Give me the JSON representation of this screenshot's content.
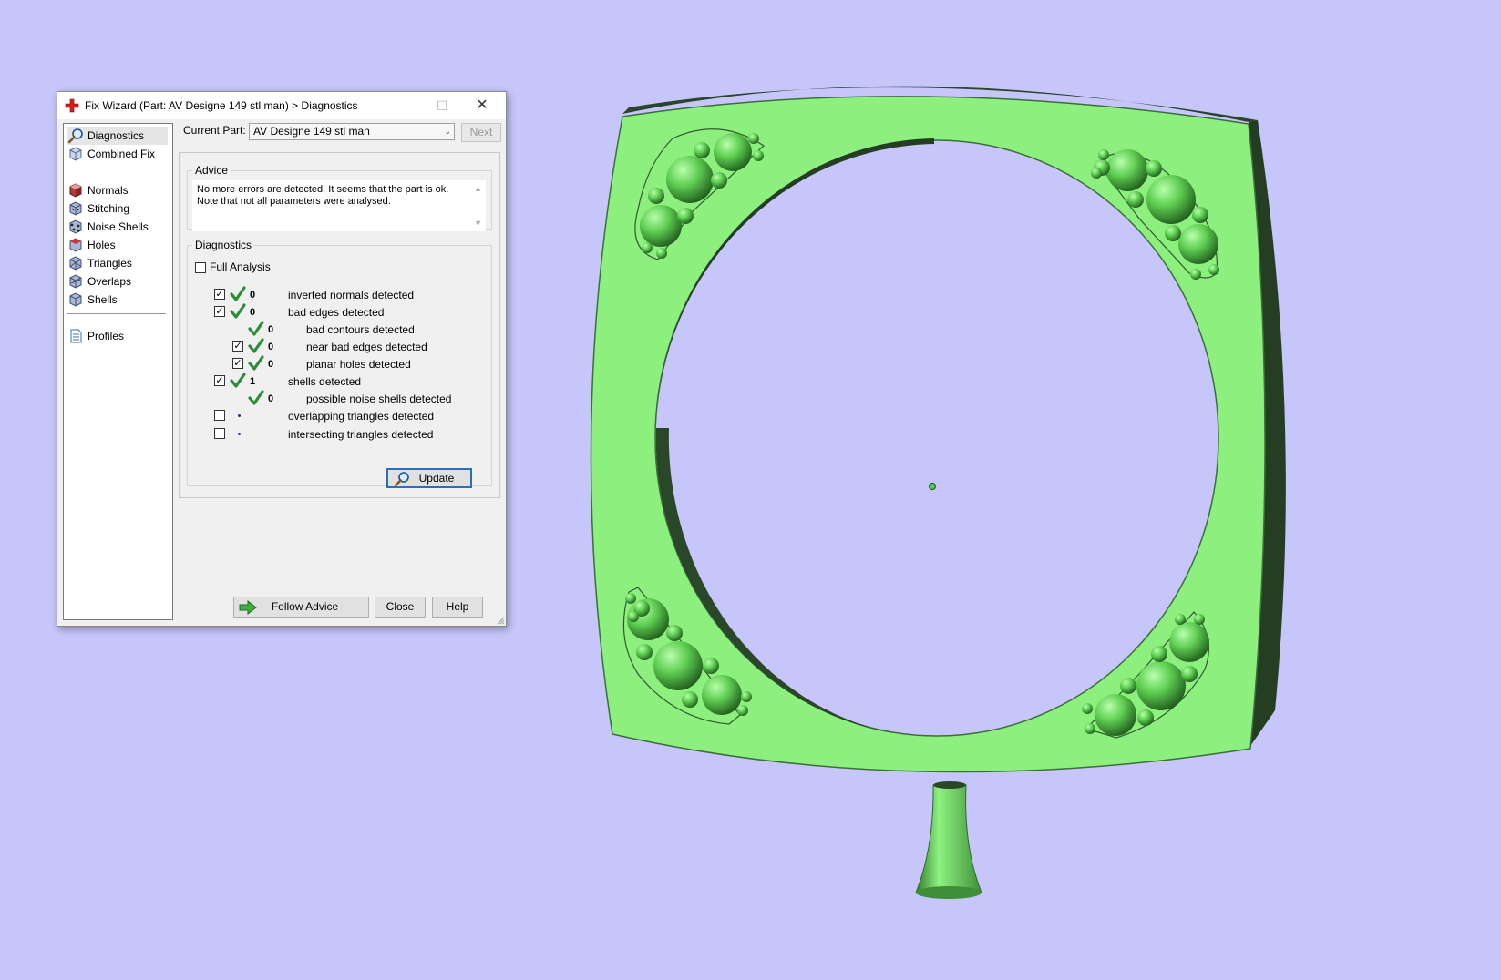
{
  "dialog": {
    "title": "Fix Wizard (Part: AV Designe 149 stl man) > Diagnostics",
    "current_part_label": "Current Part:",
    "current_part_value": "AV Designe 149 stl man",
    "next_label": "Next",
    "nav": {
      "items": [
        {
          "label": "Diagnostics",
          "icon": "magnifier-icon",
          "selected": true
        },
        {
          "label": "Combined Fix",
          "icon": "combined-fix-icon"
        },
        {
          "label": "Normals",
          "icon": "normals-cube-icon"
        },
        {
          "label": "Stitching",
          "icon": "stitching-cube-icon"
        },
        {
          "label": "Noise Shells",
          "icon": "noise-shells-cube-icon"
        },
        {
          "label": "Holes",
          "icon": "holes-cube-icon"
        },
        {
          "label": "Triangles",
          "icon": "triangles-cube-icon"
        },
        {
          "label": "Overlaps",
          "icon": "overlaps-cube-icon"
        },
        {
          "label": "Shells",
          "icon": "shells-cube-icon"
        },
        {
          "label": "Profiles",
          "icon": "profiles-document-icon"
        }
      ]
    },
    "advice": {
      "legend": "Advice",
      "text": "No more errors are detected. It seems that the part is ok. Note that not all parameters were analysed."
    },
    "diagnostics": {
      "legend": "Diagnostics",
      "full_analysis_label": "Full Analysis",
      "full_analysis_checked": false,
      "rows": [
        {
          "value": "0",
          "label": "inverted normals detected",
          "checked": true,
          "status": "ok"
        },
        {
          "value": "0",
          "label": "bad edges detected",
          "checked": true,
          "status": "ok"
        },
        {
          "value": "0",
          "label": "bad contours detected",
          "status": "ok"
        },
        {
          "value": "0",
          "label": "near bad edges detected",
          "checked": true,
          "status": "ok"
        },
        {
          "value": "0",
          "label": "planar holes detected",
          "checked": true,
          "status": "ok"
        },
        {
          "value": "1",
          "label": "shells detected",
          "checked": true,
          "status": "ok"
        },
        {
          "value": "0",
          "label": "possible noise shells detected",
          "status": "ok"
        },
        {
          "value": "",
          "label": "overlapping triangles detected",
          "checked": false,
          "status": "pending"
        },
        {
          "value": "",
          "label": "intersecting triangles detected",
          "checked": false,
          "status": "pending"
        }
      ],
      "update_label": "Update"
    },
    "buttons": {
      "follow_advice": "Follow Advice",
      "close": "Close",
      "help": "Help"
    }
  },
  "colors": {
    "background": "#c6c6fa",
    "model_green": "#8cef7e",
    "model_dark": "#233c22",
    "check_green": "#2e8b3a"
  }
}
